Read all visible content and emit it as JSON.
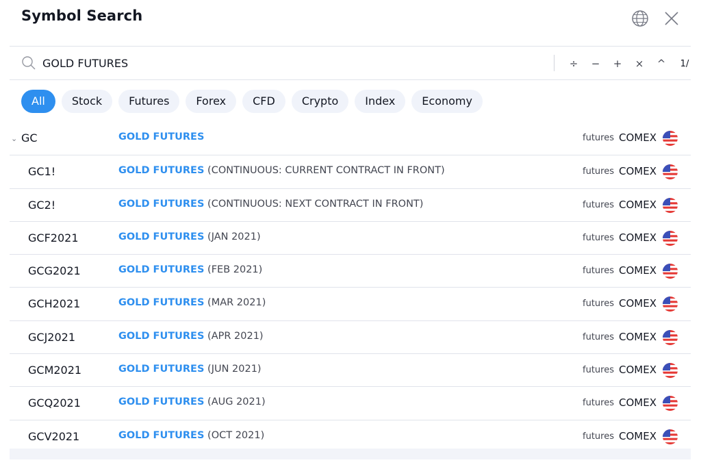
{
  "dialog": {
    "title": "Symbol Search"
  },
  "header_icons": {
    "globe": "globe-icon",
    "close": "close-icon"
  },
  "search": {
    "value": "GOLD FUTURES",
    "icon": "search-icon",
    "tools": {
      "divide": "÷",
      "minus": "−",
      "plus": "+",
      "times": "×",
      "caret": "^",
      "count": "1/"
    }
  },
  "filters": [
    "All",
    "Stock",
    "Futures",
    "Forex",
    "CFD",
    "Crypto",
    "Index",
    "Economy"
  ],
  "active_filter": "All",
  "colors": {
    "accent": "#2e8fef",
    "chip_bg": "#f0f3fa",
    "divider": "#e0e3eb"
  },
  "results": [
    {
      "symbol": "GC",
      "desc": "GOLD FUTURES",
      "suffix": "",
      "type": "futures",
      "exchange": "COMEX",
      "group": true
    },
    {
      "symbol": "GC1!",
      "desc": "GOLD FUTURES",
      "suffix": " (CONTINUOUS: CURRENT CONTRACT IN FRONT)",
      "type": "futures",
      "exchange": "COMEX"
    },
    {
      "symbol": "GC2!",
      "desc": "GOLD FUTURES",
      "suffix": " (CONTINUOUS: NEXT CONTRACT IN FRONT)",
      "type": "futures",
      "exchange": "COMEX"
    },
    {
      "symbol": "GCF2021",
      "desc": "GOLD FUTURES",
      "suffix": " (JAN 2021)",
      "type": "futures",
      "exchange": "COMEX"
    },
    {
      "symbol": "GCG2021",
      "desc": "GOLD FUTURES",
      "suffix": " (FEB 2021)",
      "type": "futures",
      "exchange": "COMEX"
    },
    {
      "symbol": "GCH2021",
      "desc": "GOLD FUTURES",
      "suffix": " (MAR 2021)",
      "type": "futures",
      "exchange": "COMEX"
    },
    {
      "symbol": "GCJ2021",
      "desc": "GOLD FUTURES",
      "suffix": " (APR 2021)",
      "type": "futures",
      "exchange": "COMEX"
    },
    {
      "symbol": "GCM2021",
      "desc": "GOLD FUTURES",
      "suffix": " (JUN 2021)",
      "type": "futures",
      "exchange": "COMEX"
    },
    {
      "symbol": "GCQ2021",
      "desc": "GOLD FUTURES",
      "suffix": " (AUG 2021)",
      "type": "futures",
      "exchange": "COMEX"
    },
    {
      "symbol": "GCV2021",
      "desc": "GOLD FUTURES",
      "suffix": " (OCT 2021)",
      "type": "futures",
      "exchange": "COMEX"
    }
  ]
}
